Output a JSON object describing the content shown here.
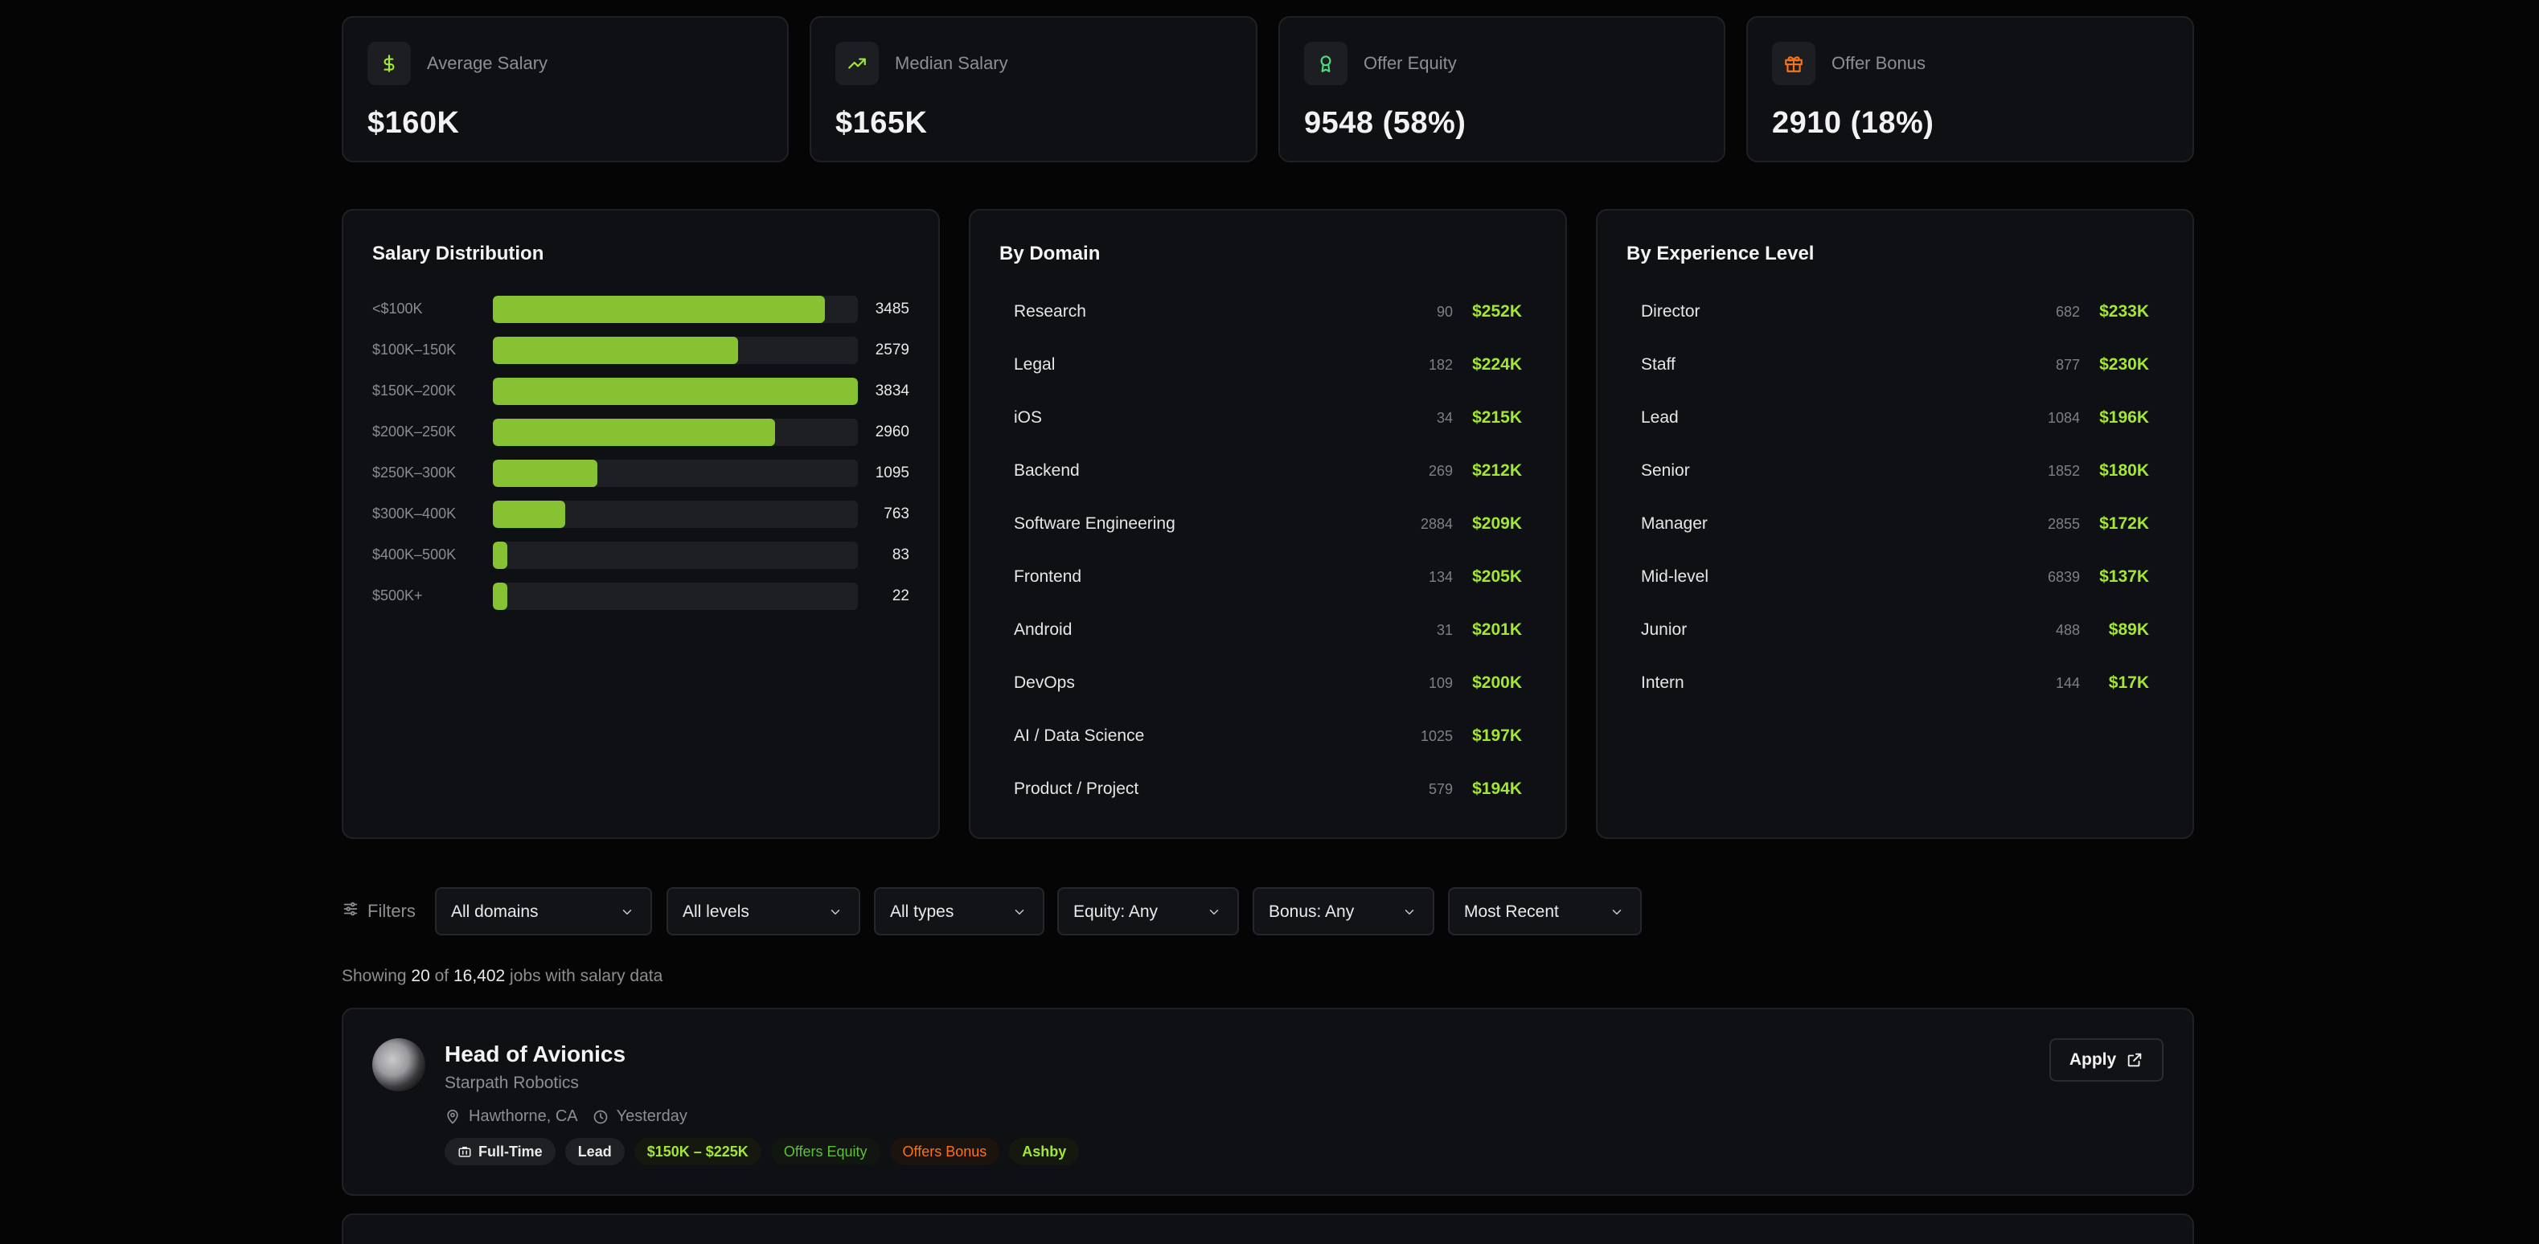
{
  "stats": [
    {
      "label": "Average Salary",
      "value": "$160K",
      "icon": "dollar-icon",
      "color": "#a3e635"
    },
    {
      "label": "Median Salary",
      "value": "$165K",
      "icon": "trending-up-icon",
      "color": "#a3e635"
    },
    {
      "label": "Offer Equity",
      "value": "9548 (58%)",
      "icon": "award-icon",
      "color": "#4ade80"
    },
    {
      "label": "Offer Bonus",
      "value": "2910 (18%)",
      "icon": "gift-icon",
      "color": "#f97316"
    }
  ],
  "distribution": {
    "title": "Salary Distribution",
    "max": 3834,
    "rows": [
      {
        "label": "<$100K",
        "count": "3485",
        "value": 3485
      },
      {
        "label": "$100K–150K",
        "count": "2579",
        "value": 2579
      },
      {
        "label": "$150K–200K",
        "count": "3834",
        "value": 3834
      },
      {
        "label": "$200K–250K",
        "count": "2960",
        "value": 2960
      },
      {
        "label": "$250K–300K",
        "count": "1095",
        "value": 1095
      },
      {
        "label": "$300K–400K",
        "count": "763",
        "value": 763
      },
      {
        "label": "$400K–500K",
        "count": "83",
        "value": 83
      },
      {
        "label": "$500K+",
        "count": "22",
        "value": 22
      }
    ]
  },
  "by_domain": {
    "title": "By Domain",
    "rows": [
      {
        "name": "Research",
        "count": "90",
        "salary": "$252K"
      },
      {
        "name": "Legal",
        "count": "182",
        "salary": "$224K"
      },
      {
        "name": "iOS",
        "count": "34",
        "salary": "$215K"
      },
      {
        "name": "Backend",
        "count": "269",
        "salary": "$212K"
      },
      {
        "name": "Software Engineering",
        "count": "2884",
        "salary": "$209K"
      },
      {
        "name": "Frontend",
        "count": "134",
        "salary": "$205K"
      },
      {
        "name": "Android",
        "count": "31",
        "salary": "$201K"
      },
      {
        "name": "DevOps",
        "count": "109",
        "salary": "$200K"
      },
      {
        "name": "AI / Data Science",
        "count": "1025",
        "salary": "$197K"
      },
      {
        "name": "Product / Project",
        "count": "579",
        "salary": "$194K"
      }
    ]
  },
  "by_level": {
    "title": "By Experience Level",
    "rows": [
      {
        "name": "Director",
        "count": "682",
        "salary": "$233K"
      },
      {
        "name": "Staff",
        "count": "877",
        "salary": "$230K"
      },
      {
        "name": "Lead",
        "count": "1084",
        "salary": "$196K"
      },
      {
        "name": "Senior",
        "count": "1852",
        "salary": "$180K"
      },
      {
        "name": "Manager",
        "count": "2855",
        "salary": "$172K"
      },
      {
        "name": "Mid-level",
        "count": "6839",
        "salary": "$137K"
      },
      {
        "name": "Junior",
        "count": "488",
        "salary": "$89K"
      },
      {
        "name": "Intern",
        "count": "144",
        "salary": "$17K"
      }
    ]
  },
  "filters": {
    "label": "Filters",
    "selects": [
      "All domains",
      "All levels",
      "All types",
      "Equity: Any",
      "Bonus: Any",
      "Most Recent"
    ]
  },
  "showing": {
    "prefix": "Showing",
    "shown": "20",
    "of": "of",
    "total": "16,402",
    "suffix": "jobs with salary data"
  },
  "job": {
    "title": "Head of Avionics",
    "company": "Starpath Robotics",
    "location": "Hawthorne, CA",
    "posted": "Yesterday",
    "apply": "Apply",
    "tags": {
      "type": "Full-Time",
      "level": "Lead",
      "salary": "$150K – $225K",
      "equity": "Offers Equity",
      "bonus": "Offers Bonus",
      "source": "Ashby"
    }
  }
}
